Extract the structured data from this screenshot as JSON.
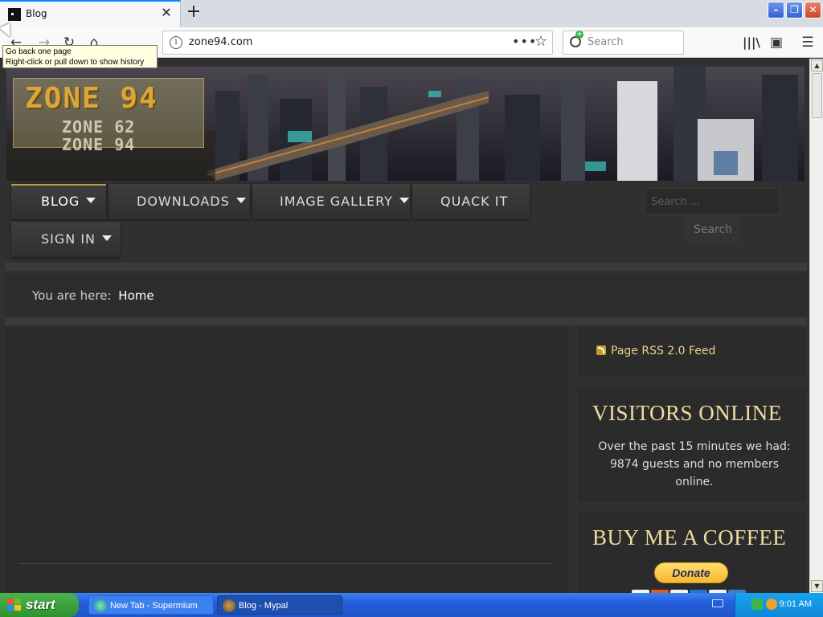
{
  "browser": {
    "tab": {
      "title": "Blog"
    },
    "url": "zone94.com",
    "search_placeholder": "Search",
    "tooltip": {
      "line1": "Go back one page",
      "line2": "Right-click or pull down to show history"
    }
  },
  "site": {
    "logo": {
      "main": "ZONE 94",
      "sub1": "ZONE 62",
      "sub2": "ZONE 94"
    },
    "menu": [
      {
        "label": "BLOG",
        "dropdown": true,
        "active": true
      },
      {
        "label": "DOWNLOADS",
        "dropdown": true
      },
      {
        "label": "IMAGE GALLERY",
        "dropdown": true
      },
      {
        "label": "QUACK IT",
        "dropdown": false
      },
      {
        "label": "SIGN IN",
        "dropdown": true
      }
    ],
    "search": {
      "placeholder": "Search ...",
      "button": "Search"
    },
    "breadcrumb": {
      "prefix": "You are here:",
      "current": "Home"
    },
    "sidebar": {
      "rss_link": "Page RSS 2.0 Feed",
      "visitors_title": "VISITORS ONLINE",
      "visitors_text": "Over the past 15 minutes we had: 9874 guests and no members online.",
      "coffee_title": "BUY ME A COFFEE",
      "donate_label": "Donate"
    }
  },
  "taskbar": {
    "start_label": "start",
    "tasks": [
      {
        "label": "New Tab - Supermium",
        "active": false
      },
      {
        "label": "Blog - Mypal",
        "active": true
      }
    ],
    "clock": "9:01 AM"
  },
  "colors": {
    "accent_gold": "#f0dca0",
    "menu_bg": "#3a3a3a",
    "page_bg": "#303030",
    "taskbar_blue": "#245edb"
  }
}
